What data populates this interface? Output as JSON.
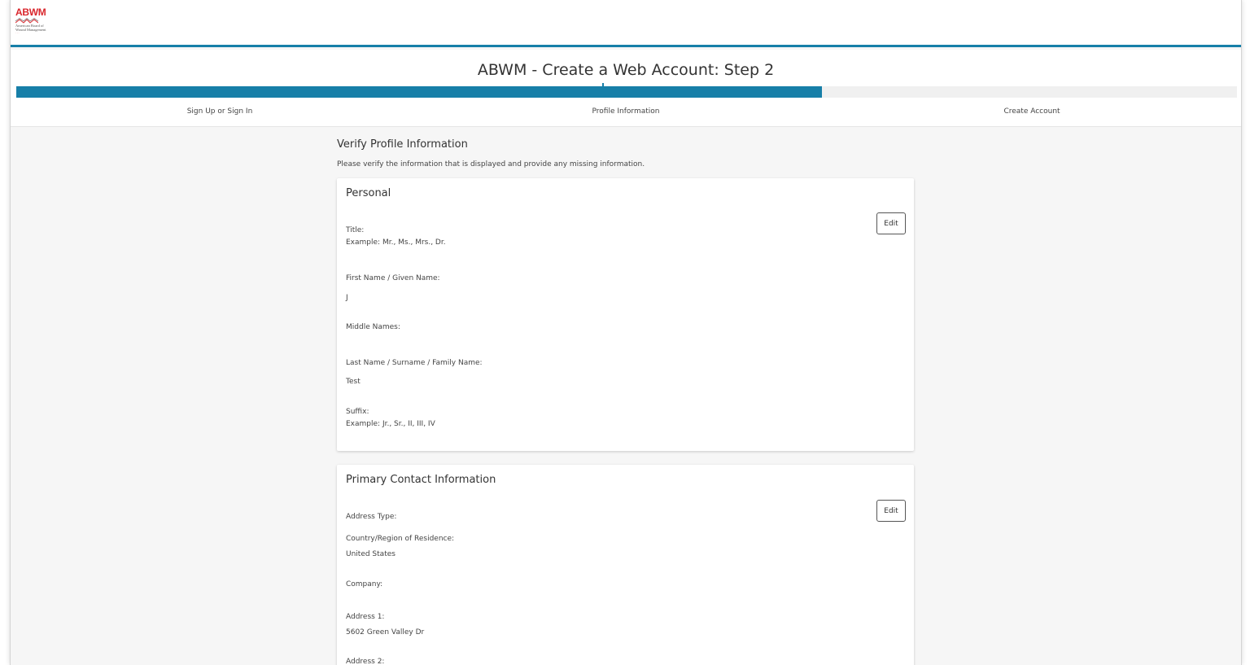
{
  "logo": {
    "abbr": "ABWM",
    "line1": "American Board of",
    "line2": "Wound Management",
    "tagline": "· · ·",
    "brand_color": "#d9262c"
  },
  "page_title": "ABWM - Create a Web Account: Step 2",
  "stepper": {
    "progress_fraction": 0.66,
    "accent_color": "#177fa8",
    "steps": [
      {
        "label": "Sign Up or Sign In"
      },
      {
        "label": "Profile Information"
      },
      {
        "label": "Create Account"
      }
    ]
  },
  "section": {
    "heading": "Verify Profile Information",
    "description": "Please verify the information that is displayed and provide any missing information."
  },
  "personal": {
    "title": "Personal",
    "edit_label": "Edit",
    "fields": {
      "title_label": "Title:",
      "title_hint": "Example: Mr., Ms., Mrs., Dr.",
      "first_label": "First Name / Given Name:",
      "first_value": "J",
      "middle_label": "Middle Names:",
      "last_label": "Last Name / Surname / Family Name:",
      "last_value": "Test",
      "suffix_label": "Suffix:",
      "suffix_hint": "Example: Jr., Sr., II, III, IV"
    }
  },
  "contact": {
    "title": "Primary Contact Information",
    "edit_label": "Edit",
    "fields": {
      "address_type_label": "Address Type:",
      "country_label": "Country/Region of Residence:",
      "country_value": "United States",
      "company_label": "Company:",
      "address1_label": "Address 1:",
      "address1_value": "5602 Green Valley Dr",
      "address2_label": "Address 2:"
    }
  }
}
